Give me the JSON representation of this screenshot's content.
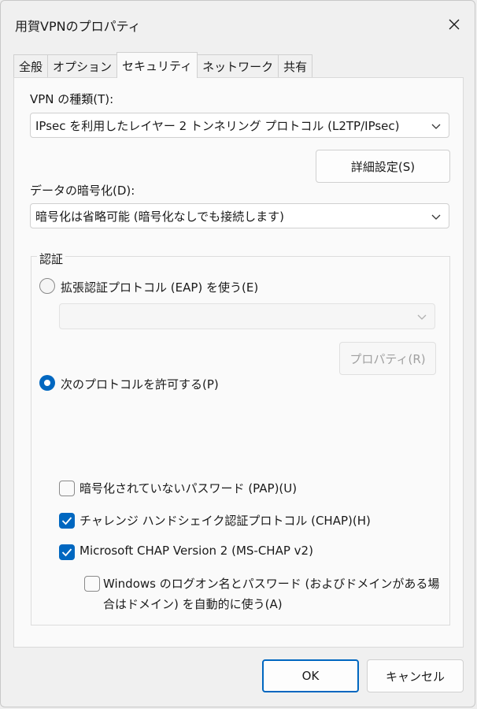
{
  "window": {
    "title": "用賀VPNのプロパティ"
  },
  "tabs": [
    {
      "label": "全般"
    },
    {
      "label": "オプション"
    },
    {
      "label": "セキュリティ"
    },
    {
      "label": "ネットワーク"
    },
    {
      "label": "共有"
    }
  ],
  "active_tab": "セキュリティ",
  "vpn_type": {
    "label": "VPN の種類(T):",
    "value": "IPsec を利用したレイヤー 2 トンネリング プロトコル (L2TP/IPsec)"
  },
  "advanced_button": {
    "label": "詳細設定(S)"
  },
  "encryption": {
    "label": "データの暗号化(D):",
    "value": "暗号化は省略可能 (暗号化なしでも接続します)"
  },
  "auth": {
    "group_label": "認証",
    "eap_radio": {
      "label": "拡張認証プロトコル (EAP) を使う(E)",
      "checked": false
    },
    "eap_combo": {
      "value": ""
    },
    "properties_button": {
      "label": "プロパティ(R)"
    },
    "allow_radio": {
      "label": "次のプロトコルを許可する(P)",
      "checked": true
    },
    "protocols": [
      {
        "label": "暗号化されていないパスワード (PAP)(U)",
        "checked": false
      },
      {
        "label": "チャレンジ ハンドシェイク認証プロトコル (CHAP)(H)",
        "checked": true
      },
      {
        "label": "Microsoft CHAP Version 2 (MS-CHAP v2)",
        "checked": true
      }
    ],
    "windows_logon": {
      "line1": "Windows のログオン名とパスワード (およびドメインがある場",
      "line2": "合はドメイン) を自動的に使う(A)",
      "checked": false
    }
  },
  "footer": {
    "ok_label": "OK",
    "cancel_label": "キャンセル"
  },
  "colors": {
    "accent": "#0067c0",
    "panel_bg": "#fafafa",
    "dialog_bg": "#f0f0f0"
  }
}
